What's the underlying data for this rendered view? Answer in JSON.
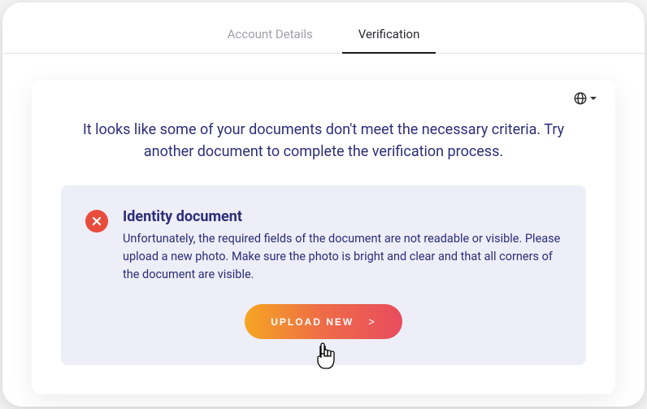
{
  "tabs": {
    "account_details": "Account Details",
    "verification": "Verification"
  },
  "main_message": "It looks like some of your documents don't meet the necessary criteria. Try another document to complete the verification process.",
  "error": {
    "title": "Identity document",
    "description": "Unfortunately, the required fields of the document are not readable or visible. Please upload a new photo. Make sure the photo is bright and clear and that all corners of the document are visible."
  },
  "upload_button": {
    "label": "UPLOAD NEW",
    "arrow": ">"
  }
}
